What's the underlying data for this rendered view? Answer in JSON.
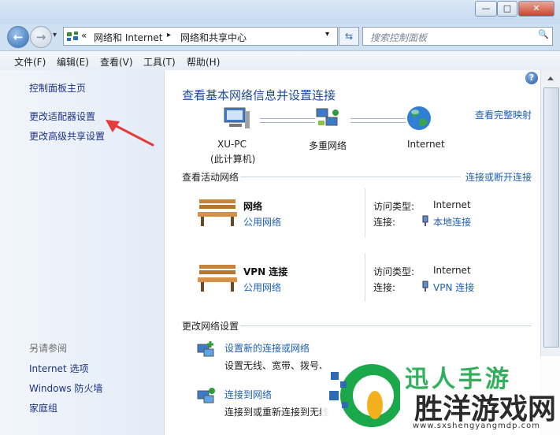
{
  "window": {
    "controls": {
      "minimize": "—",
      "maximize": "□",
      "close": "✕"
    }
  },
  "nav": {
    "back": "←",
    "forward": "→",
    "dropdown": "▾"
  },
  "address": {
    "prefix": "«",
    "crumbs": [
      "网络和 Internet",
      "网络和共享中心"
    ],
    "sep": "▸",
    "dropdown": "▾",
    "refresh": "⇆",
    "search_placeholder": "搜索控制面板",
    "search_icon": "🔍"
  },
  "menubar": [
    "文件(F)",
    "编辑(E)",
    "查看(V)",
    "工具(T)",
    "帮助(H)"
  ],
  "sidebar": {
    "links": [
      "控制面板主页",
      "更改适配器设置",
      "更改高级共享设置"
    ],
    "see_also_title": "另请参阅",
    "see_also": [
      "Internet 选项",
      "Windows 防火墙",
      "家庭组"
    ]
  },
  "main": {
    "help": "?",
    "heading": "查看基本网络信息并设置连接",
    "full_map": "查看完整映射",
    "map": {
      "pc_name": "XU-PC",
      "pc_sub": "(此计算机)",
      "middle": "多重网络",
      "internet": "Internet"
    },
    "active_title": "查看活动网络",
    "connect_disconnect": "连接或断开连接",
    "networks": [
      {
        "name": "网络",
        "type_link": "公用网络",
        "access_label": "访问类型:",
        "access_value": "Internet",
        "conn_label": "连接:",
        "conn_value": "本地连接"
      },
      {
        "name": "VPN 连接",
        "type_link": "公用网络",
        "access_label": "访问类型:",
        "access_value": "Internet",
        "conn_label": "连接:",
        "conn_value": "VPN 连接"
      }
    ],
    "change_title": "更改网络设置",
    "tasks": [
      {
        "link": "设置新的连接或网络",
        "desc": "设置无线、宽带、拨号、"
      },
      {
        "link": "连接到网络",
        "desc": "连接到或重新连接到无线"
      }
    ]
  },
  "watermark": {
    "title": "胜洋游戏网",
    "url": "www.sxshengyangmdp.com",
    "overlay": "迅人手游"
  },
  "colors": {
    "accent": "#1e5fb4",
    "arrow": "#e53b3b",
    "watermark": "#1ba84a"
  }
}
